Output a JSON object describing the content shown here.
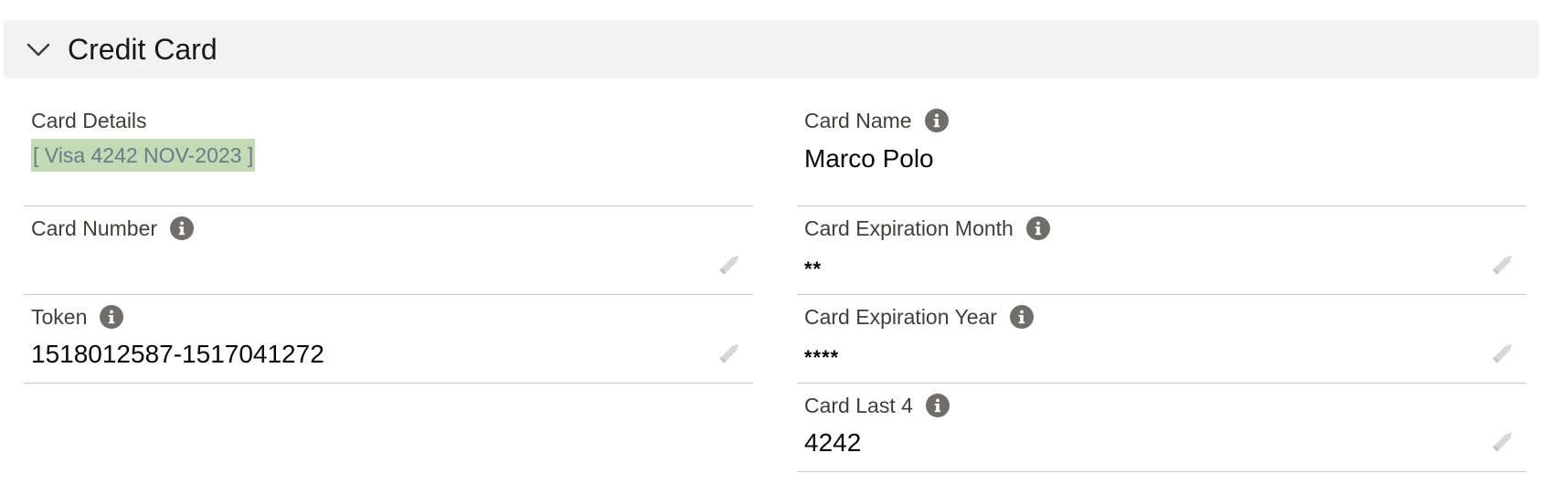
{
  "section": {
    "title": "Credit Card"
  },
  "left_column": {
    "card_details": {
      "label": "Card Details",
      "value": "[ Visa 4242 NOV-2023 ]"
    },
    "card_number": {
      "label": "Card Number",
      "value": ""
    },
    "token": {
      "label": "Token",
      "value": "1518012587-1517041272"
    }
  },
  "right_column": {
    "card_name": {
      "label": "Card Name",
      "value": "Marco Polo"
    },
    "card_expiration_month": {
      "label": "Card Expiration Month",
      "value": "**"
    },
    "card_expiration_year": {
      "label": "Card Expiration Year",
      "value": "****"
    },
    "card_last_4": {
      "label": "Card Last 4",
      "value": "4242"
    }
  },
  "icons": {
    "collapse": "chevron-down-icon",
    "info": "info-icon",
    "edit": "pencil-icon"
  },
  "colors": {
    "header_bg": "#f3f2f2",
    "info_icon": "#706e6b",
    "highlight": "#c2dbb5",
    "link_text": "#6b7a8c",
    "divider": "#c9c9c9"
  }
}
